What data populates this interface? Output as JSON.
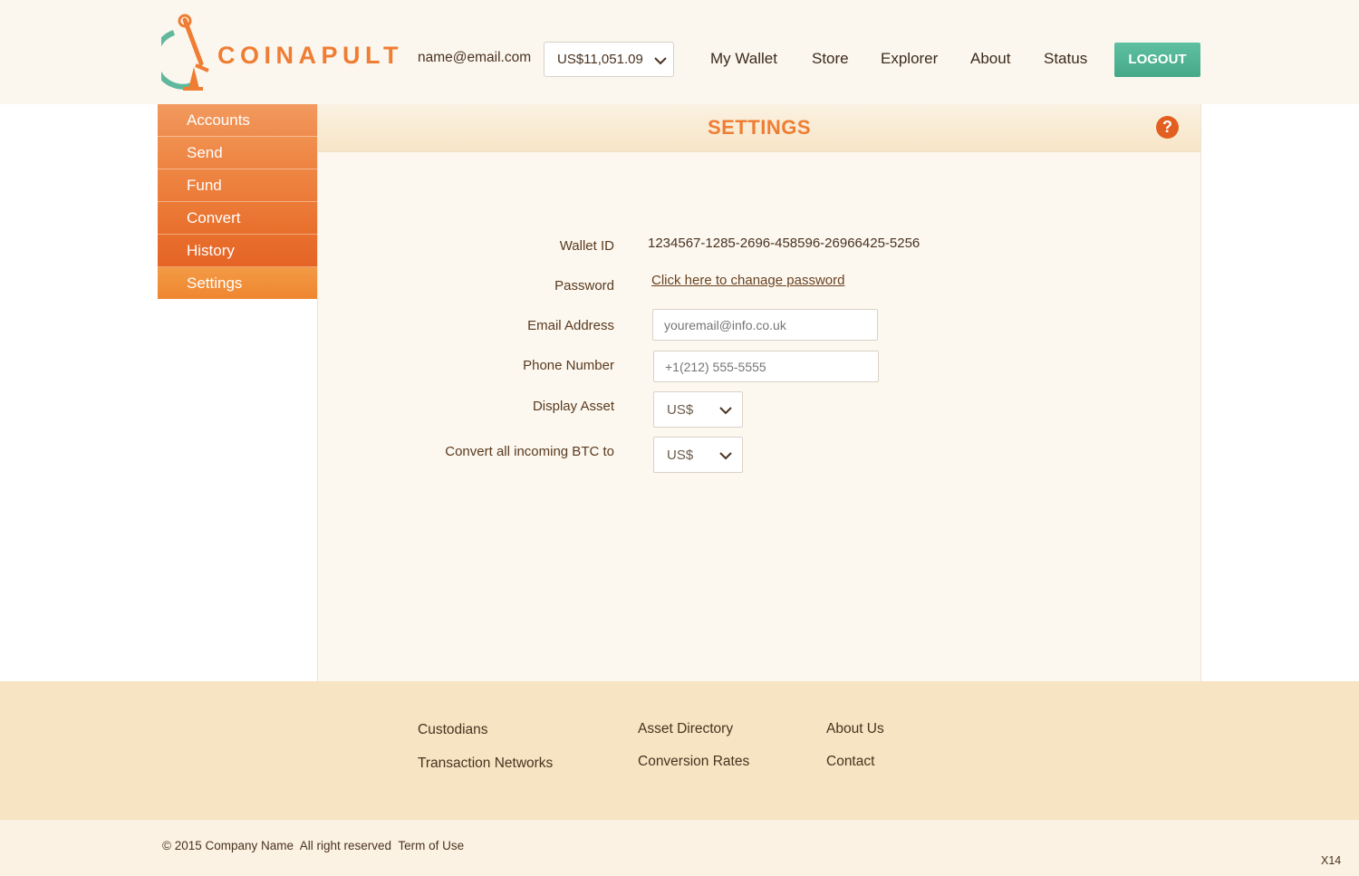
{
  "header": {
    "brand": "COINAPULT",
    "user_email": "name@email.com",
    "balance": "US$11,051.09",
    "nav": [
      "My Wallet",
      "Store",
      "Explorer",
      "About",
      "Status"
    ],
    "logout_label": "LOGOUT"
  },
  "sidebar": {
    "items": [
      {
        "label": "Accounts"
      },
      {
        "label": "Send"
      },
      {
        "label": "Fund"
      },
      {
        "label": "Convert"
      },
      {
        "label": "History"
      },
      {
        "label": "Settings"
      }
    ],
    "active": "Settings"
  },
  "settings": {
    "title": "SETTINGS",
    "help_glyph": "?",
    "wallet_id_label": "Wallet ID",
    "wallet_id": "1234567-1285-2696-458596-26966425-5256",
    "password_label": "Password",
    "password_link": "Click here to chanage password",
    "email_label": "Email Address",
    "email_placeholder": "youremail@info.co.uk",
    "phone_label": "Phone Number",
    "phone_placeholder": "+1(212) 555-5555",
    "display_asset_label": "Display Asset",
    "display_asset_value": "US$",
    "convert_label": "Convert all incoming BTC to",
    "convert_value": "US$"
  },
  "footer": {
    "col1": [
      "Custodians",
      "Transaction Networks"
    ],
    "col2": [
      "Asset Directory",
      "Conversion Rates"
    ],
    "col3": [
      "About Us",
      "Contact"
    ],
    "copyright": "© 2015 Company Name  All right reserved  Term of Use",
    "page_id": "X14"
  },
  "colors": {
    "accent_orange": "#ef7d33",
    "logout_green": "#4fb393",
    "footer_bg": "#f6e4c2"
  }
}
